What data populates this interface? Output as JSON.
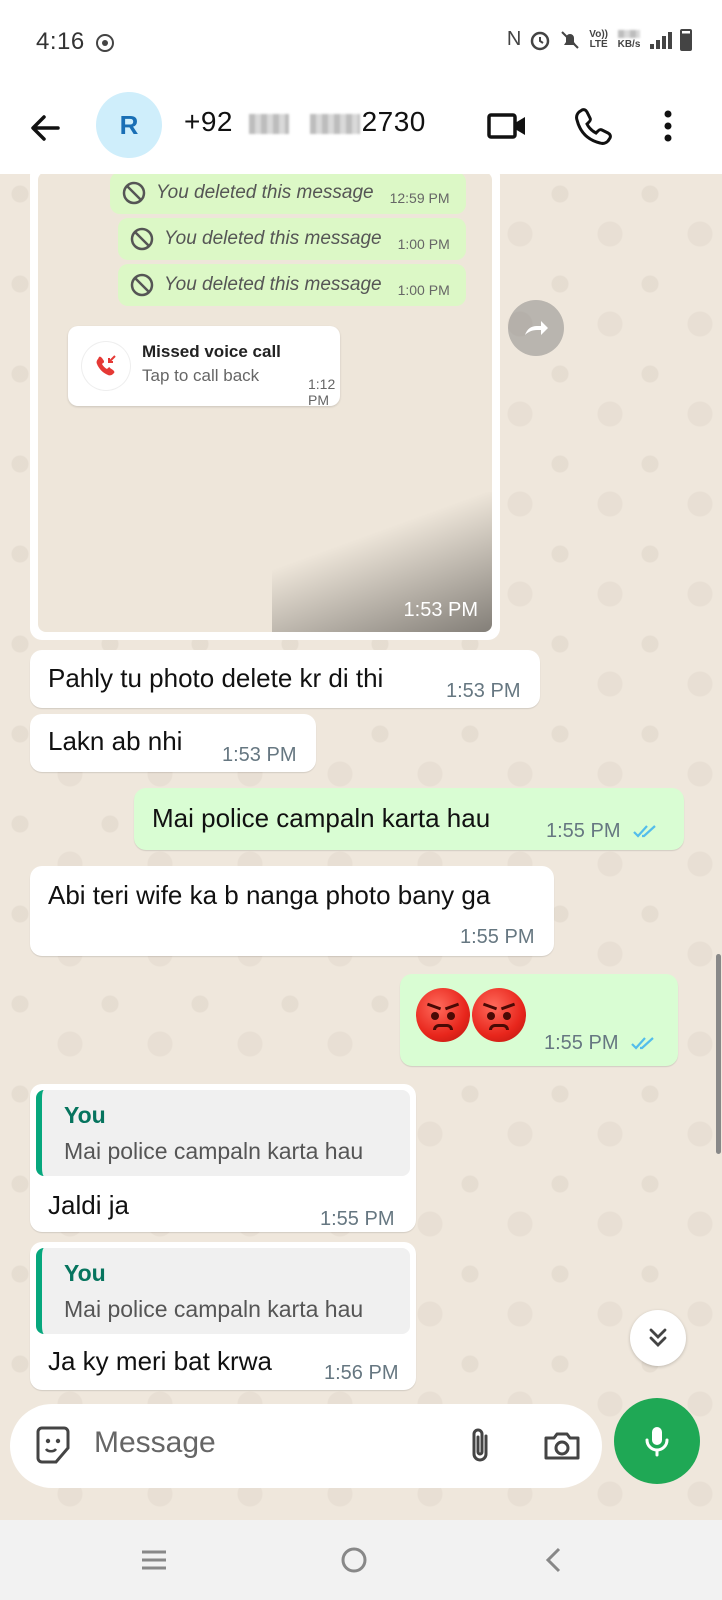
{
  "status_bar": {
    "time": "4:16",
    "network_top": "Vo))",
    "network_bottom": "LTE",
    "speed_unit": "KB/s"
  },
  "header": {
    "avatar_letter": "R",
    "contact_prefix": "+92",
    "contact_suffix": "2730"
  },
  "forwarded_image": {
    "time": "1:53 PM",
    "deleted_messages": [
      {
        "text": "You deleted this message",
        "time": "12:59 PM"
      },
      {
        "text": "You deleted this message",
        "time": "1:00 PM"
      },
      {
        "text": "You deleted this message",
        "time": "1:00 PM"
      }
    ],
    "missed_call": {
      "title": "Missed voice call",
      "subtitle": "Tap to call back",
      "time": "1:12 PM"
    }
  },
  "messages": [
    {
      "text": "Pahly tu photo delete kr di thi",
      "time": "1:53 PM",
      "direction": "in"
    },
    {
      "text": "Lakn ab nhi",
      "time": "1:53 PM",
      "direction": "in"
    },
    {
      "text": "Mai police campaln karta hau",
      "time": "1:55 PM",
      "direction": "out",
      "read": true
    },
    {
      "text": "Abi teri wife ka b nanga photo bany ga",
      "time": "1:55 PM",
      "direction": "in"
    },
    {
      "emoji": "angry-face-emoji x2",
      "time": "1:55 PM",
      "direction": "out",
      "read": true
    },
    {
      "quote_name": "You",
      "quote_text": "Mai police campaln karta hau",
      "text": "Jaldi ja",
      "time": "1:55 PM",
      "direction": "in"
    },
    {
      "quote_name": "You",
      "quote_text": "Mai police campaln karta hau",
      "text": "Ja ky meri bat krwa",
      "time": "1:56 PM",
      "direction": "in"
    }
  ],
  "composer": {
    "placeholder": "Message"
  },
  "colors": {
    "outgoing_bubble": "#d9fdd3",
    "incoming_bubble": "#ffffff",
    "chat_background": "#efe7dc",
    "accent_green": "#1fa855",
    "read_ticks": "#53bdeb"
  }
}
